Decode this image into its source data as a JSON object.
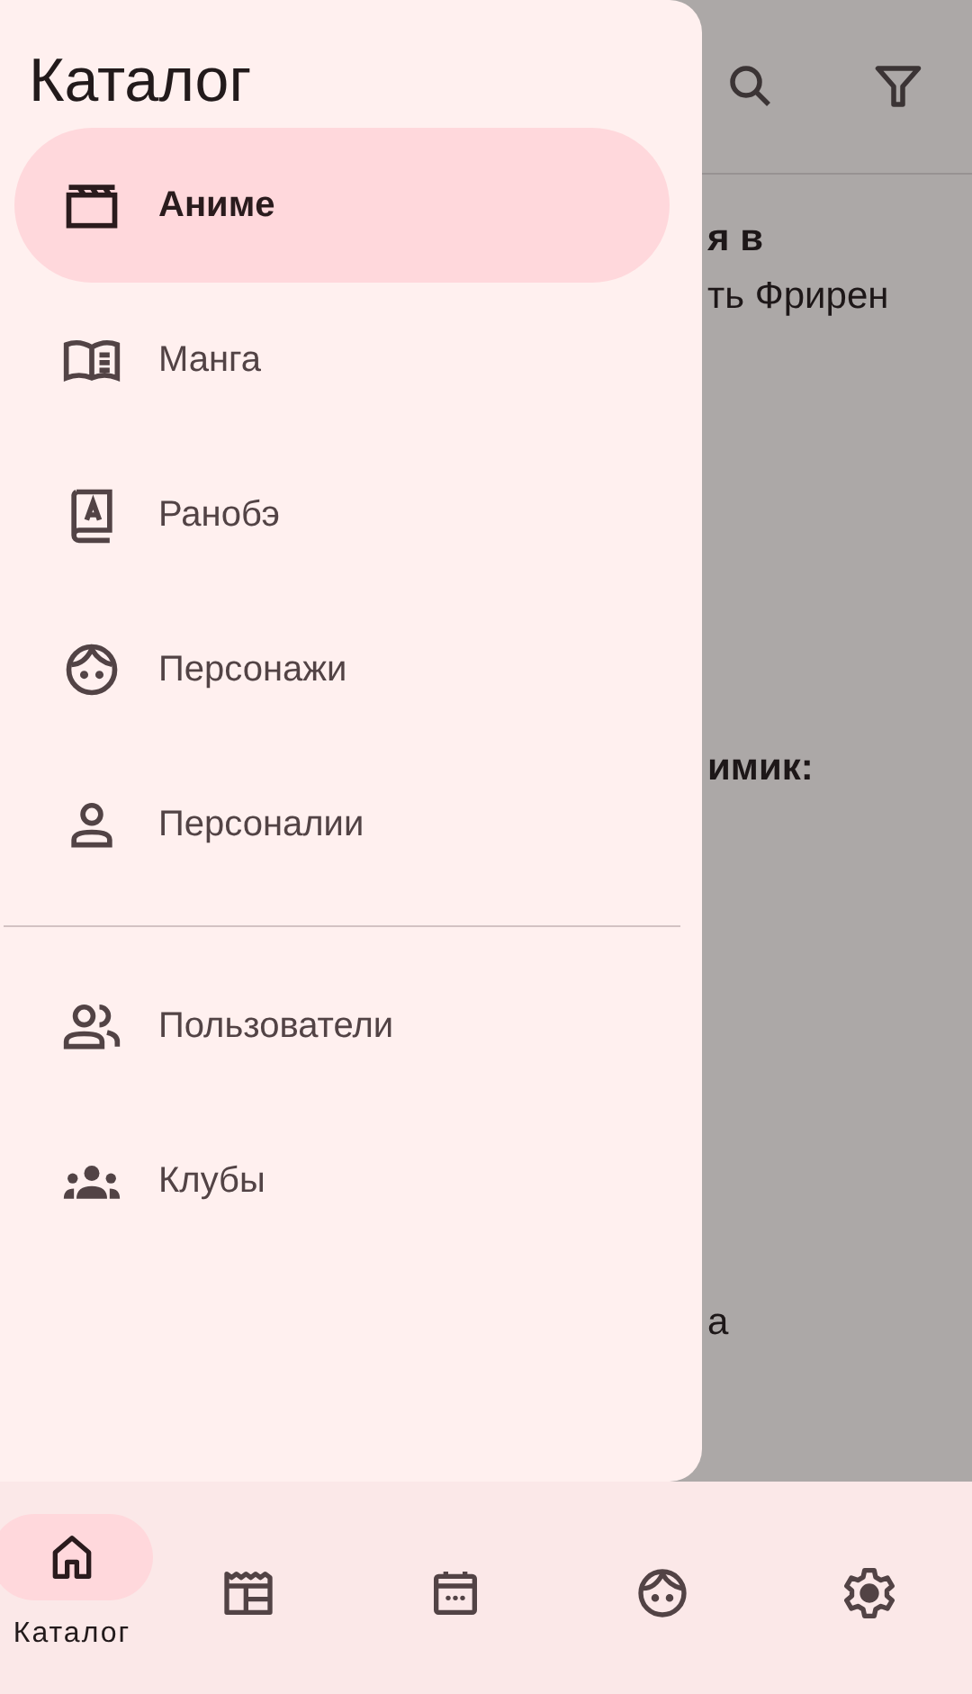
{
  "content": {
    "texts": [
      "я в",
      "ть Фрирен",
      "имик:",
      "а"
    ]
  },
  "drawer": {
    "title": "Каталог",
    "groups": [
      {
        "items": [
          {
            "label": "Аниме",
            "selected": true
          },
          {
            "label": "Манга",
            "selected": false
          },
          {
            "label": "Ранобэ",
            "selected": false
          },
          {
            "label": "Персонажи",
            "selected": false
          },
          {
            "label": "Персоналии",
            "selected": false
          }
        ]
      },
      {
        "items": [
          {
            "label": "Пользователи",
            "selected": false
          },
          {
            "label": "Клубы",
            "selected": false
          }
        ]
      }
    ]
  },
  "bottom_nav": [
    {
      "label": "Каталог",
      "selected": true
    },
    {
      "selected": false
    },
    {
      "selected": false
    },
    {
      "selected": false
    },
    {
      "selected": false
    }
  ]
}
